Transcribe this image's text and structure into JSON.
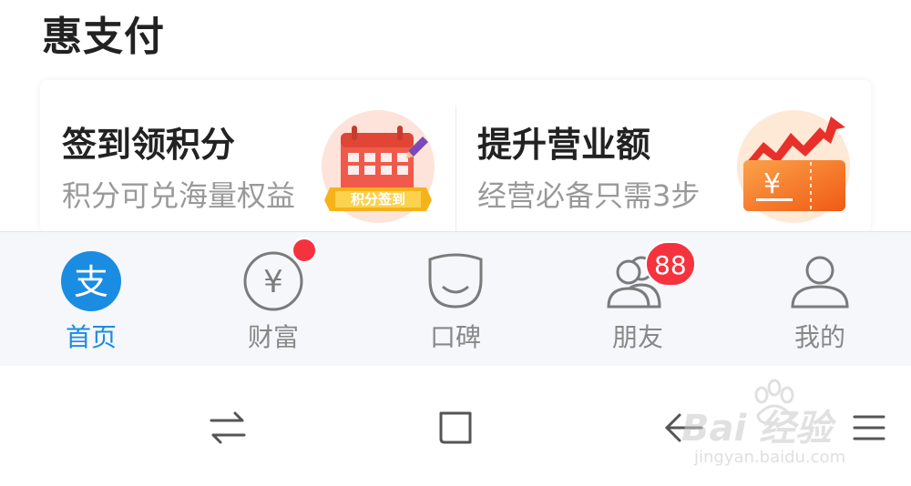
{
  "section": {
    "title": "惠支付"
  },
  "cards": [
    {
      "title": "签到领积分",
      "subtitle": "积分可兑海量权益",
      "badge_text": "积分签到",
      "icon": "calendar-checkin-icon"
    },
    {
      "title": "提升营业额",
      "subtitle": "经营必备只需3步",
      "coupon_symbol": "¥",
      "icon": "coupon-growth-icon"
    }
  ],
  "tabbar": {
    "tabs": [
      {
        "label": "首页",
        "icon": "alipay-logo-icon",
        "glyph": "支",
        "active": true
      },
      {
        "label": "财富",
        "icon": "yen-coin-icon",
        "glyph": "¥",
        "badge": "dot"
      },
      {
        "label": "口碑",
        "icon": "koubei-smile-icon"
      },
      {
        "label": "朋友",
        "icon": "friends-icon",
        "badge": "88"
      },
      {
        "label": "我的",
        "icon": "profile-icon"
      }
    ]
  },
  "watermark": {
    "text": "Bai 经验",
    "url": "jingyan.baidu.com"
  },
  "colors": {
    "accent": "#1a8ce2",
    "badge": "#f5333f",
    "tabbar_bg": "#f5f7fb",
    "text_primary": "#222222",
    "text_secondary": "#999999"
  }
}
